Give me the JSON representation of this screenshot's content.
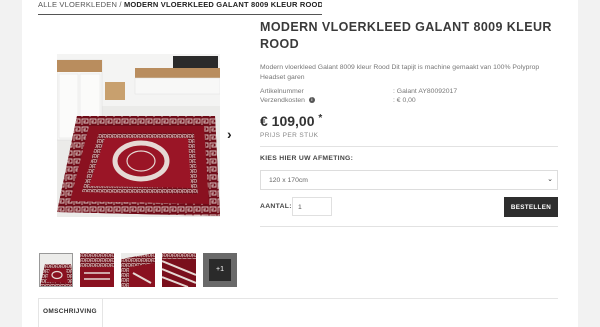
{
  "breadcrumb": {
    "parent": "ALLE VLOERKLEDEN",
    "separator": " / ",
    "current": "MODERN VLOERKLEED GALANT 8009 KLEUR ROOD"
  },
  "product": {
    "title": "MODERN VLOERKLEED GALANT 8009 KLEUR ROOD",
    "description": "Modern vloerkleed Galant 8009 kleur Rood Dit tapijt is machine gemaakt van 100% Polyprop Headset garen",
    "specs": [
      {
        "label": "Artikelnummer",
        "value": ": Galant AY80092017"
      },
      {
        "label": "Verzendkosten",
        "value": ": € 0,00"
      }
    ],
    "price": "€ 109,00",
    "price_marker": "*",
    "price_unit": "PRIJS PER STUK"
  },
  "options": {
    "size_label": "KIES HIER UW AFMETING:",
    "size_value": "120 x 170cm"
  },
  "purchase": {
    "qty_label": "AANTAL:",
    "qty_value": "1",
    "button_label": "BESTELLEN"
  },
  "gallery": {
    "more_label": "+1"
  },
  "tabs": [
    {
      "label": "OMSCHRIJVING"
    }
  ],
  "icons": {
    "info": "info-icon",
    "next": "chevron-right-icon",
    "dropdown": "chevron-down-icon"
  },
  "colors": {
    "rug_red": "#7a0f1c",
    "rug_pattern": "#e6d9d4",
    "button": "#2e2e2e"
  }
}
